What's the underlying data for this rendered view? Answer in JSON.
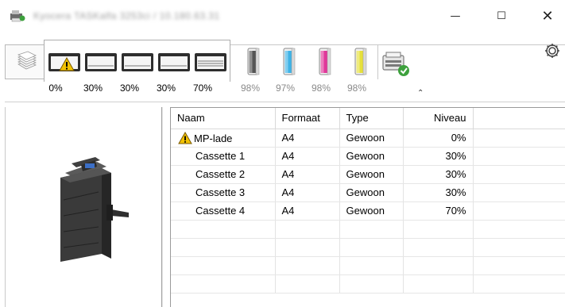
{
  "window": {
    "title": "Kyocera TASKalfa 3253ci / 10.180.63.31",
    "controls": {
      "minimize": "—",
      "maximize": "☐",
      "close": "✕"
    }
  },
  "toolbar": {
    "trays": [
      {
        "name": "MP-lade",
        "level": "0%",
        "warning": true
      },
      {
        "name": "Cassette 1",
        "level": "30%"
      },
      {
        "name": "Cassette 2",
        "level": "30%"
      },
      {
        "name": "Cassette 3",
        "level": "30%"
      },
      {
        "name": "Cassette 4",
        "level": "70%"
      }
    ],
    "toners": [
      {
        "color": "#555555",
        "level": "98%"
      },
      {
        "color": "#3fb3e6",
        "level": "97%"
      },
      {
        "color": "#e0389a",
        "level": "98%"
      },
      {
        "color": "#e6e03a",
        "level": "98%"
      }
    ],
    "collapse_glyph": "⌃",
    "icons": [
      "paper-stack-icon",
      "tray-icon",
      "toner-icon",
      "device-status-icon",
      "settings-gear-icon",
      "warning-icon"
    ]
  },
  "table": {
    "columns": [
      "Naam",
      "Formaat",
      "Type",
      "Niveau",
      ""
    ],
    "rows": [
      {
        "name": "MP-lade",
        "format": "A4",
        "type": "Gewoon",
        "level": "0%",
        "warning": true
      },
      {
        "name": "Cassette 1",
        "format": "A4",
        "type": "Gewoon",
        "level": "30%"
      },
      {
        "name": "Cassette 2",
        "format": "A4",
        "type": "Gewoon",
        "level": "30%"
      },
      {
        "name": "Cassette 3",
        "format": "A4",
        "type": "Gewoon",
        "level": "30%"
      },
      {
        "name": "Cassette 4",
        "format": "A4",
        "type": "Gewoon",
        "level": "70%"
      }
    ]
  },
  "colors": {
    "warning": "#f2c200",
    "ok_check": "#3da13d",
    "toner_outline": "#8a8a8a"
  }
}
